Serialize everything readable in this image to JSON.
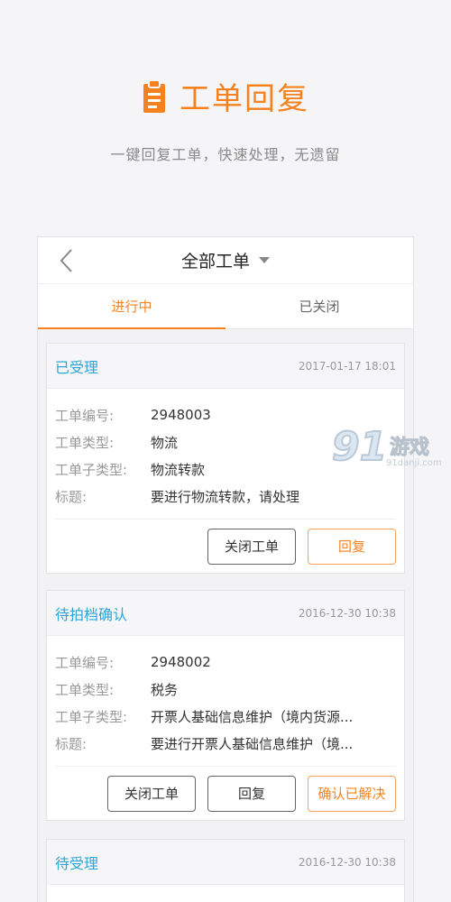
{
  "hero": {
    "title": "工单回复",
    "subtitle": "一键回复工单，快速处理，无遗留"
  },
  "navbar": {
    "title": "全部工单",
    "back_icon": "chevron-left-icon",
    "dropdown_icon": "caret-down-icon"
  },
  "tabs": [
    {
      "label": "进行中",
      "active": true
    },
    {
      "label": "已关闭",
      "active": false
    }
  ],
  "labels": {
    "number": "工单编号:",
    "type": "工单类型:",
    "subtype": "工单子类型:",
    "title": "标题:"
  },
  "cards": [
    {
      "status": "已受理",
      "time": "2017-01-17 18:01",
      "number": "2948003",
      "type": "物流",
      "subtype": "物流转款",
      "title": "要进行物流转款，请处理",
      "buttons": [
        "关闭工单",
        "回复"
      ]
    },
    {
      "status": "待拍档确认",
      "time": "2016-12-30 10:38",
      "number": "2948002",
      "type": "税务",
      "subtype": "开票人基础信息维护（境内货源...",
      "title": "要进行开票人基础信息维护（境...",
      "buttons": [
        "关闭工单",
        "回复",
        "确认已解决"
      ]
    },
    {
      "status": "待受理",
      "time": "2016-12-30 10:38"
    }
  ],
  "watermark": {
    "number": "91",
    "text": "游戏",
    "url": "91danji.com"
  },
  "colors": {
    "accent": "#f5821f",
    "status": "#2ba6d8",
    "background": "#f5f5f7"
  }
}
